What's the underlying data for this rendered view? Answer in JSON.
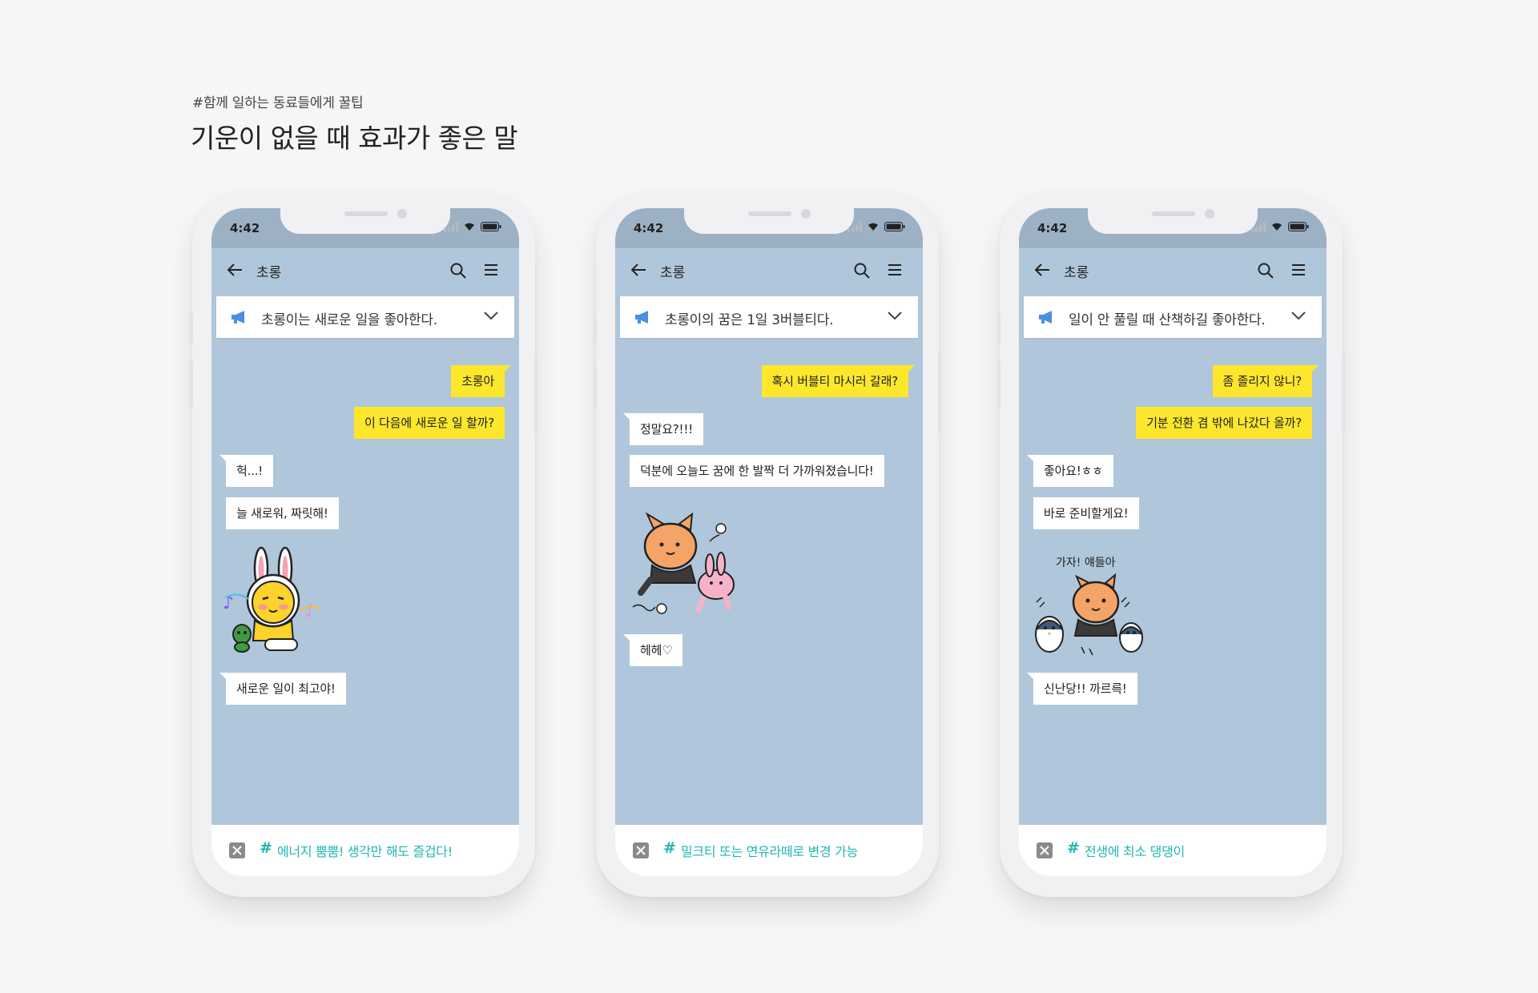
{
  "hero": {
    "tag": "#함께 일하는 동료들에게 꿀팁",
    "title": "기운이 없을 때 효과가 좋은 말"
  },
  "colors": {
    "background": "#f6f6f6",
    "chat_bg": "#b0c6da",
    "status_bar": "#9db1c5",
    "my_bubble": "#fde72c",
    "their_bubble": "#ffffff",
    "hashtag": "#1fb7b3"
  },
  "phones": [
    {
      "time": "4:42",
      "chat_title": "초롱",
      "notice": "초롱이는 새로운 일을 좋아한다.",
      "messages": [
        "초롱아",
        "이 다음에 새로운 일 할까?",
        "헉...!",
        "늘 새로워, 짜릿해!",
        "새로운 일이 최고야!"
      ],
      "sticker": "rabbit-costume-character-dancing-sticker",
      "hashtag": "에너지 뿜뿜! 생각만 해도 즐겁다!"
    },
    {
      "time": "4:42",
      "chat_title": "초롱",
      "notice": "초롱이의 꿈은 1일 3버블티다.",
      "messages": [
        "혹시 버블티 마시러 갈래?",
        "정말요?!!!",
        "덕분에 오늘도 꿈에 한 발짝 더 가까워졌습니다!",
        "헤헤♡"
      ],
      "sticker": "raccoon-and-pink-rabbit-flying-sticker",
      "hashtag": "밀크티 또는 연유라떼로 변경 가능"
    },
    {
      "time": "4:42",
      "chat_title": "초롱",
      "notice": "일이 안 풀릴 때 산책하길 좋아한다.",
      "messages": [
        "좀 졸리지 않니?",
        "기분 전환 겸 밖에 나갔다 올까?",
        "좋아요!ㅎㅎ",
        "바로 준비할게요!",
        "신난당!! 까르륵!"
      ],
      "sticker": "raccoon-with-penguins-sticker",
      "sticker_text": "가자! 얘들아",
      "hashtag": "전생에 최소 댕댕이"
    }
  ]
}
